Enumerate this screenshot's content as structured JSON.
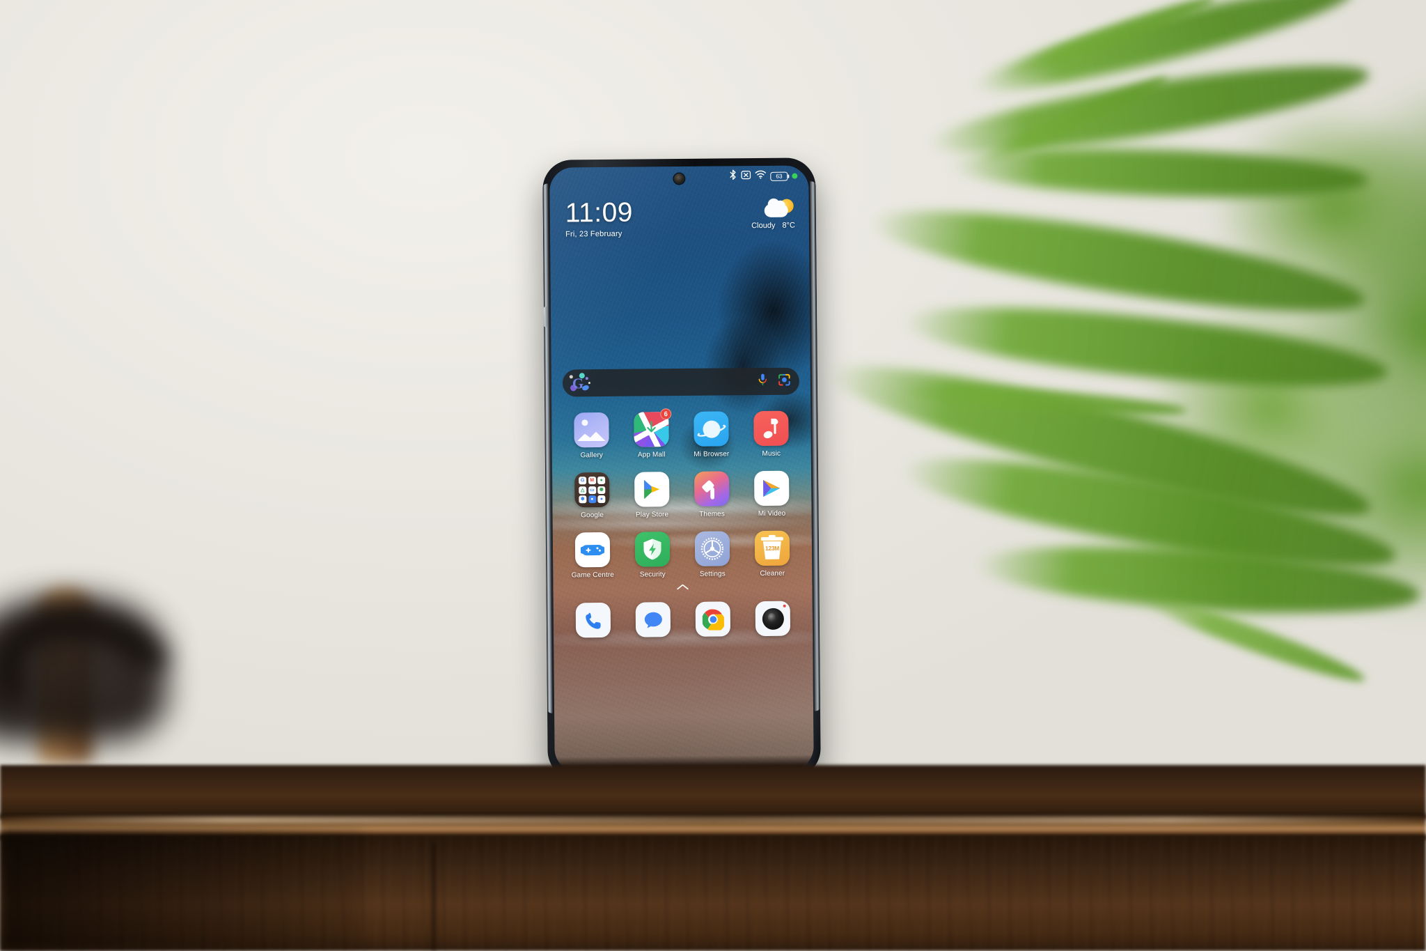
{
  "scene": {
    "description": "Smartphone standing on a dark wooden table, white wall and blurred green fern in background",
    "background_color": "#eceae4",
    "table_color": "#3c2615",
    "plant_color": "#5c9428"
  },
  "phone": {
    "frame_color": "#16191e",
    "camera": "punch-hole-camera"
  },
  "status_bar": {
    "icons": [
      "bluetooth-icon",
      "vibrate-icon",
      "wifi-icon",
      "battery-icon",
      "recording-dot-icon"
    ],
    "battery_level": "63",
    "indicator_color": "#38d25a"
  },
  "clock_widget": {
    "time": "11:09",
    "date": "Fri, 23 February"
  },
  "weather_widget": {
    "icon": "partly-cloudy-icon",
    "condition": "Cloudy",
    "temperature": "8°C"
  },
  "search_bar": {
    "logo": "google-g-logo",
    "placeholder": "",
    "value": "",
    "mic_icon": "microphone-icon",
    "lens_icon": "google-lens-icon",
    "background_color": "#212428"
  },
  "app_grid": {
    "rows": [
      [
        {
          "label": "Gallery",
          "icon": "gallery-icon",
          "badge": ""
        },
        {
          "label": "App Mall",
          "icon": "app-mall-icon",
          "badge": "6"
        },
        {
          "label": "Mi Browser",
          "icon": "mi-browser-icon",
          "badge": ""
        },
        {
          "label": "Music",
          "icon": "music-icon",
          "badge": ""
        }
      ],
      [
        {
          "label": "Google",
          "icon": "google-folder-icon",
          "badge": ""
        },
        {
          "label": "Play Store",
          "icon": "play-store-icon",
          "badge": ""
        },
        {
          "label": "Themes",
          "icon": "themes-icon",
          "badge": ""
        },
        {
          "label": "Mi Video",
          "icon": "mi-video-icon",
          "badge": ""
        }
      ],
      [
        {
          "label": "Game Centre",
          "icon": "game-centre-icon",
          "badge": ""
        },
        {
          "label": "Security",
          "icon": "security-icon",
          "badge": ""
        },
        {
          "label": "Settings",
          "icon": "settings-icon",
          "badge": ""
        },
        {
          "label": "Cleaner",
          "icon": "cleaner-icon",
          "badge": ""
        }
      ]
    ],
    "folder_apps": [
      "G",
      "M",
      "⊙",
      "△",
      "▭",
      "❈",
      "✽",
      "◉",
      "●"
    ],
    "cleaner_size": "123M"
  },
  "page_indicator": {
    "icon": "chevron-up-icon"
  },
  "dock": {
    "items": [
      {
        "label": "Phone",
        "icon": "phone-icon"
      },
      {
        "label": "Messages",
        "icon": "messages-icon"
      },
      {
        "label": "Chrome",
        "icon": "chrome-icon"
      },
      {
        "label": "Camera",
        "icon": "camera-icon"
      }
    ]
  }
}
